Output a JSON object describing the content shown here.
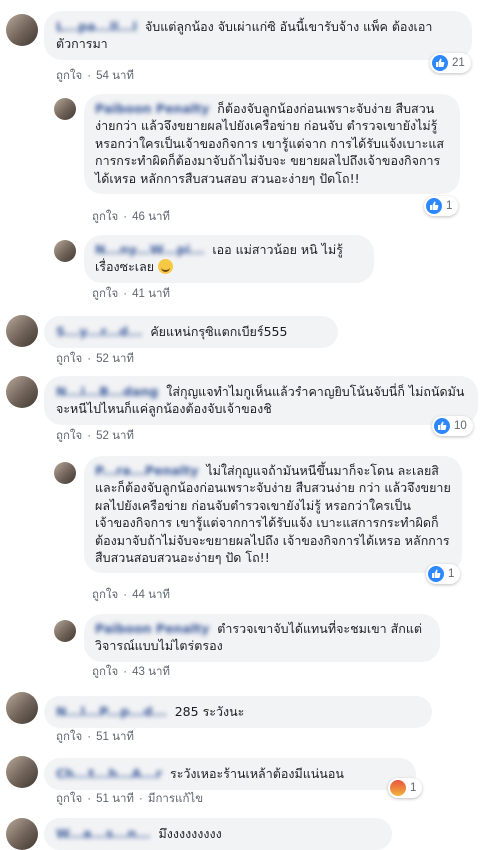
{
  "labels": {
    "like": "ถูกใจ",
    "edited": "มีการแก้ไข"
  },
  "comments": [
    {
      "author": "L...pa...ll...l",
      "text": "จับแต่ลูกน้อง จับเผ่าแก่ซิ อันนี้เขารับจ้าง แพ็ค ต้องเอาตัวการมา",
      "time": "54 นาที",
      "reactions": "21",
      "reaction_icon": "like-icon"
    },
    {
      "author": "Paiboon Penalty",
      "text": "ก็ต้องจับลูกน้องก่อนเพราะจับง่าย สืบสวนง่ายกว่า แล้วจึงขยายผลไปยังเครือข่าย ก่อนจับ ตำรวจเขายังไม่รู้หรอกว่าใครเป็นเจ้าของกิจการ เขารู้แต่จาก การได้รับแจ้งเบาะแสการกระทำผิดก็ต้องมาจับถ้าไม่จับจะ ขยายผลไปถึงเจ้าของกิจการได้เหรอ หลักการสืบสวนสอบ สวนอะง่ายๆ ปัดโถ!!",
      "time": "46 นาที",
      "reactions": "1",
      "reaction_icon": "like-icon"
    },
    {
      "author": "N...ny...W...pi...",
      "text": "เออ แม่สาวน้อย หนิ ไม่รู้เรื่องซะเลย",
      "time": "41 นาที"
    },
    {
      "author": "S...y...r...d...",
      "text": "คัยแหน่กรุซิแตกเบียร์555",
      "time": "52 นาที"
    },
    {
      "author": "N...i...B...dang",
      "text": "ใส่กุญแจทำไมกูเห็นแล้วรำคาญยิบโน้นจับนี่ก็ ไม่ถนัดมันจะหนีไปไหนก็แค่ลูกน้องต้องจับเจ้าของชิ",
      "time": "52 นาที",
      "reactions": "10",
      "reaction_icon": "like-icon"
    },
    {
      "author": "P...ra...Penalty",
      "text": "ไม่ใส่กุญแจถ้ามันหนีขึ้นมาก็จะโดน ละเลยสิ และก็ต้องจับลูกน้องก่อนเพราะจับง่าย สืบสวนง่าย กว่า แล้วจึงขยายผลไปยังเครือข่าย ก่อนจับตำรวจเขายังไม่รู้ หรอกว่าใครเป็นเจ้าของกิจการ เขารู้แต่จากการได้รับแจ้ง เบาะแสการกระทำผิดก็ต้องมาจับถ้าไม่จับจะขยายผลไปถึง เจ้าของกิจการได้เหรอ หลักการสืบสวนสอบสวนอะง่ายๆ ปัด โถ!!",
      "time": "44 นาที",
      "reactions": "1",
      "reaction_icon": "like-icon"
    },
    {
      "author": "Paiboon Penalty",
      "text": "ตำรวจเขาจับได้แทนที่จะชมเขา สักแต่ วิจารณ์แบบไม่ไตร่ตรอง",
      "time": "43 นาที"
    },
    {
      "author": "N...l...P...p...d...",
      "text": "285 ระวังนะ",
      "time": "51 นาที"
    },
    {
      "author": "Ch...t...h...A...r",
      "text": "ระวังเหอะร้านเหล้าต้องมีแน่นอน",
      "time": "51 นาที",
      "edited": true,
      "reactions": "1",
      "reaction_icon": "angry-icon"
    },
    {
      "author": "W...a...s...n...",
      "text": "มึงงงงงงงงง",
      "time": ""
    }
  ]
}
